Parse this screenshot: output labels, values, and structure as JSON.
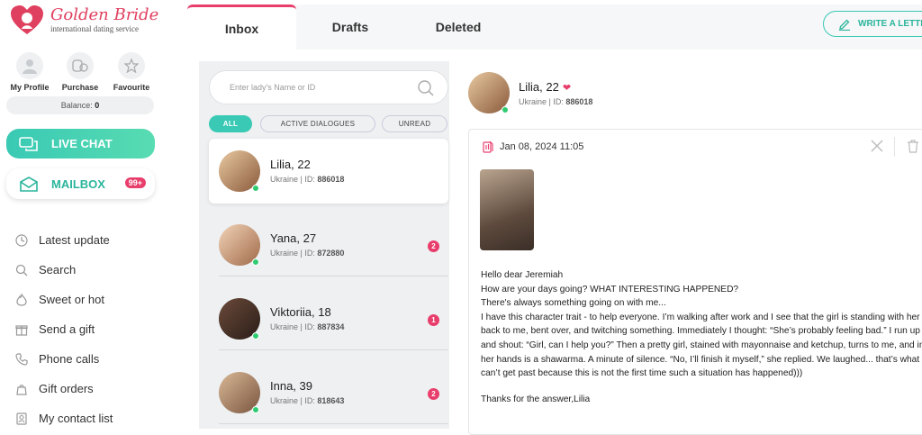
{
  "brand": {
    "title": "Golden Bride",
    "subtitle": "international dating service"
  },
  "profile_nav": [
    {
      "label": "My Profile",
      "icon": "user-icon"
    },
    {
      "label": "Purchase",
      "icon": "coins-icon"
    },
    {
      "label": "Favourite",
      "icon": "star-icon"
    }
  ],
  "balance": {
    "label": "Balance:",
    "value": "0"
  },
  "livechat": {
    "label": "LIVE CHAT"
  },
  "mailbox": {
    "label": "MAILBOX",
    "badge": "99+"
  },
  "nav": [
    {
      "label": "Latest update",
      "icon": "clock-icon"
    },
    {
      "label": "Search",
      "icon": "search-icon"
    },
    {
      "label": "Sweet or hot",
      "icon": "flame-icon"
    },
    {
      "label": "Send a gift",
      "icon": "gift-icon"
    },
    {
      "label": "Phone calls",
      "icon": "phone-icon"
    },
    {
      "label": "Gift orders",
      "icon": "gift-orders-icon"
    },
    {
      "label": "My contact list",
      "icon": "contacts-icon"
    }
  ],
  "tabs": [
    {
      "label": "Inbox",
      "active": true
    },
    {
      "label": "Drafts",
      "active": false
    },
    {
      "label": "Deleted",
      "active": false
    }
  ],
  "write_button": {
    "label": "WRITE A LETTER"
  },
  "search": {
    "placeholder": "Enter lady's Name or ID"
  },
  "filters": [
    {
      "label": "ALL",
      "active": true
    },
    {
      "label": "ACTIVE DIALOGUES",
      "active": false
    },
    {
      "label": "UNREAD",
      "active": false
    }
  ],
  "conversations": [
    {
      "name": "Lilia, 22",
      "country": "Ukraine",
      "id_label": "ID:",
      "id": "886018",
      "unread": "",
      "online": true,
      "selected": true
    },
    {
      "name": "Yana, 27",
      "country": "Ukraine",
      "id_label": "ID:",
      "id": "872880",
      "unread": "2",
      "online": true,
      "selected": false
    },
    {
      "name": "Viktoriia, 18",
      "country": "Ukraine",
      "id_label": "ID:",
      "id": "887834",
      "unread": "1",
      "online": true,
      "selected": false
    },
    {
      "name": "Inna, 39",
      "country": "Ukraine",
      "id_label": "ID:",
      "id": "818643",
      "unread": "2",
      "online": true,
      "selected": false
    }
  ],
  "detail": {
    "name": "Lilia, 22",
    "country": "Ukraine",
    "id_label": "ID:",
    "id": "886018",
    "date": "Jan 08, 2024 11:05",
    "body": [
      "Hello dear Jeremiah",
      "How are your days going? WHAT INTERESTING HAPPENED?",
      "There's always something going on with me...",
      "I have this character trait - to help everyone. I’m walking after work and I see that the girl is standing with her back to me, bent over, and twitching something. Immediately I thought: “She’s probably feeling bad.” I run up and shout: “Girl, can I help you?” Then a pretty girl, stained with mayonnaise and ketchup, turns to me, and in her hands is a shawarma. A minute of silence. “No, I’ll finish it myself,” she replied. We laughed... that’s what I can’t get past because this is not the first time such a situation has happened)))"
    ],
    "signoff": "Thanks for the answer,Lilia"
  },
  "colors": {
    "accent": "#e83e6c",
    "teal": "#39c9b4",
    "online": "#2ecc71"
  }
}
